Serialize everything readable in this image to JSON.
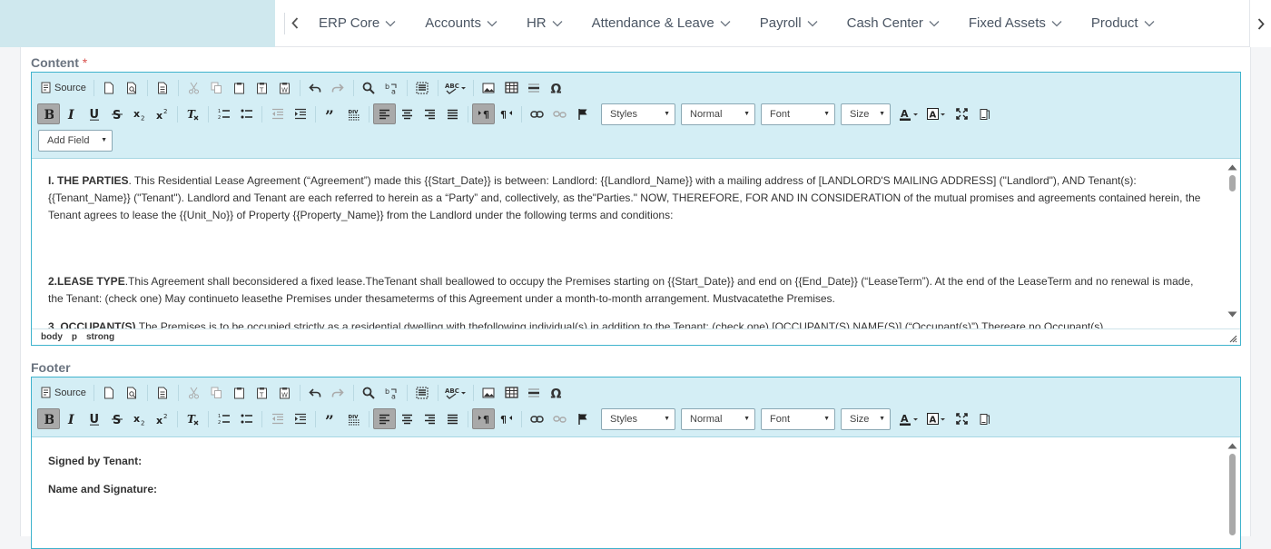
{
  "nav": {
    "items": [
      "ERP Core",
      "Accounts",
      "HR",
      "Attendance & Leave",
      "Payroll",
      "Cash Center",
      "Fixed Assets",
      "Product"
    ]
  },
  "content_field": {
    "label": "Content",
    "required_mark": "*"
  },
  "footer_field": {
    "label": "Footer"
  },
  "toolbar": {
    "source_label": "Source",
    "combos": {
      "styles": "Styles",
      "format": "Normal",
      "font": "Font",
      "size": "Size"
    },
    "add_field_label": "Add Field"
  },
  "content": {
    "p1_bold": "I. THE PARTIES",
    "p1_text": ". This Residential Lease Agreement (“Agreement”) made this {{Start_Date}} is between: Landlord: {{Landlord_Name}} with a mailing address of  [LANDLORD'S MAILING ADDRESS] (\"Landlord\"), AND Tenant(s): {{Tenant_Name}} (\"Tenant\"). Landlord and Tenant are each referred to herein as a “Party” and, collectively, as the\"Parties.\" NOW, THEREFORE, FOR AND IN CONSIDERATION of the mutual promises and agreements contained herein, the Tenant agrees to lease the {{Unit_No}} of Property {{Property_Name}} from the Landlord under the following terms and conditions:",
    "p2_bold": "2.LEASE TYPE",
    "p2_text": ".This Agreement shall beconsidered a fixed lease.TheTenant shall beallowed to occupy the Premises starting on {{Start_Date}} and end on {{End_Date}} (“LeaseTerm”). At the end of the LeaseTerm and no renewal is made, the Tenant: (check one) May continueto leasethe Premises under thesameterms of this Agreement under a month-to-month arrangement. Mustvacatethe Premises.",
    "p3_bold": "3. OCCUPANT(S).",
    "p3_text": "The Premises is to be occupied strictly as a residential dwelling with thefollowing individual(s) in addition to the Tenant: (check one) [OCCUPANT(S) NAME(S)] (“Occupant(s)”) Thereare no Occupant(s).",
    "path": [
      "body",
      "p",
      "strong"
    ]
  },
  "footer": {
    "line1": "Signed by Tenant:",
    "line2": "Name and Signature:"
  },
  "colors": {
    "accent": "#3fb3cd",
    "toolbar_bg": "#d4eef5",
    "brand_block": "#cfe8ee"
  }
}
